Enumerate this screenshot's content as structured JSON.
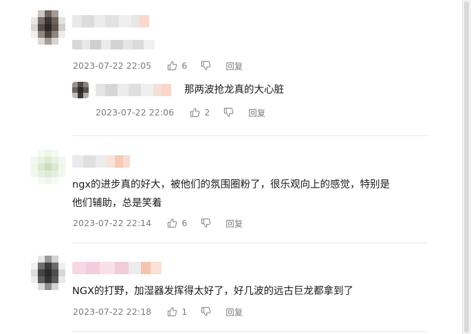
{
  "comments": [
    {
      "time": "2023-07-22 22:05",
      "likes": "6",
      "reply_label": "回复",
      "reply": {
        "text": "那两波抢龙真的大心脏",
        "time": "2023-07-22 22:06",
        "likes": "2",
        "reply_label": "回复"
      }
    },
    {
      "text_line1": "ngx的进步真的好大，被他们的氛围圈粉了，很乐观向上的感觉，特别是",
      "text_line2": "他们辅助，总是笑着",
      "time": "2023-07-22 22:14",
      "likes": "6",
      "reply_label": "回复"
    },
    {
      "text_line1": "NGX的打野，加湿器发挥得太好了，好几波的远古巨龙都拿到了",
      "time": "2023-07-22 22:18",
      "likes": "1",
      "reply_label": "回复"
    }
  ],
  "icons": {
    "like": "thumbs-up-icon",
    "dislike": "thumbs-down-icon"
  },
  "colors": {
    "meta_text": "#7a7a7a",
    "divider": "#e8e8e8",
    "blurred_name_accent": "#f6b9a5"
  }
}
